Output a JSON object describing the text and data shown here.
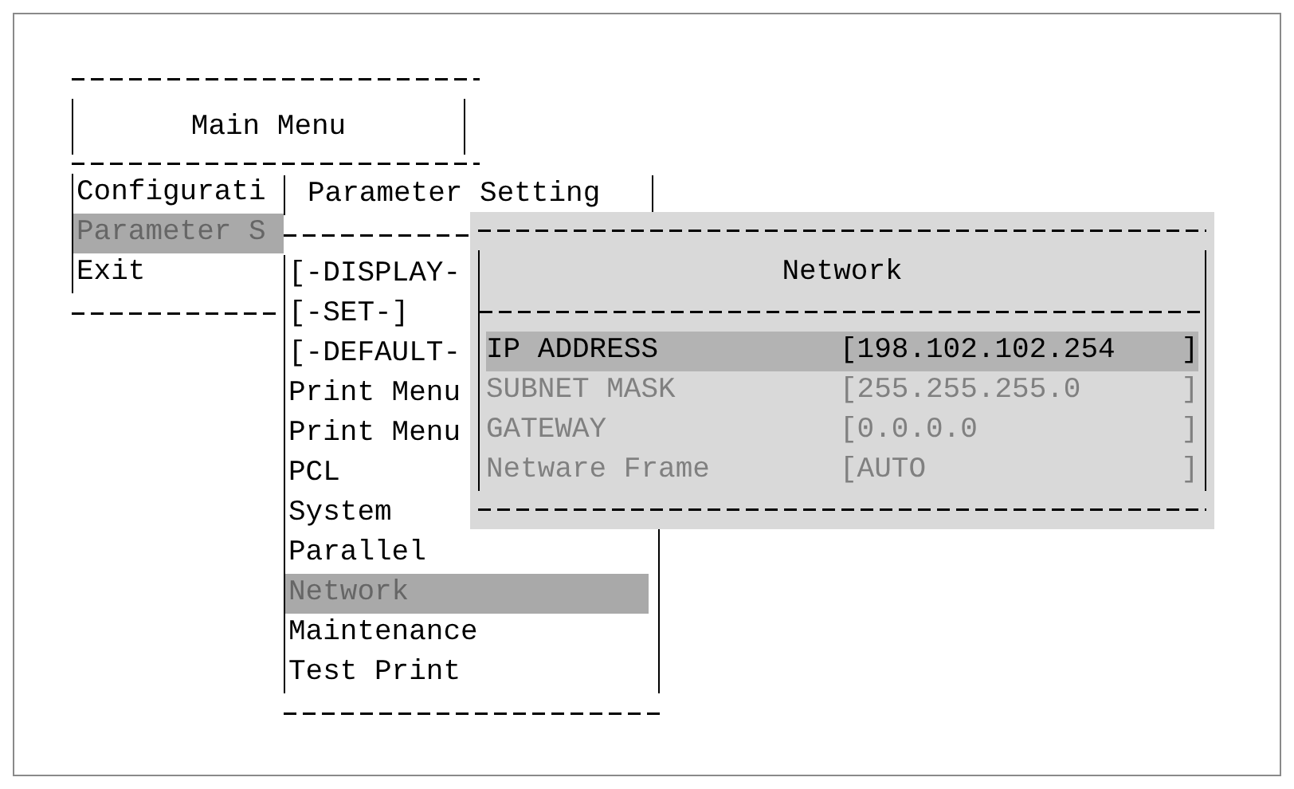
{
  "main_menu": {
    "title": "Main Menu",
    "items": [
      {
        "label": "Configurati",
        "selected": false
      },
      {
        "label": "Parameter S",
        "selected": true
      },
      {
        "label": "Exit",
        "selected": false
      }
    ]
  },
  "parameter_setting": {
    "title": "Parameter Setting",
    "items": [
      {
        "label": "[-DISPLAY-",
        "selected": false
      },
      {
        "label": "[-SET-]",
        "selected": false
      },
      {
        "label": "[-DEFAULT-",
        "selected": false
      },
      {
        "label": "Print Menu",
        "selected": false
      },
      {
        "label": "Print Menu",
        "selected": false
      },
      {
        "label": "PCL",
        "selected": false
      },
      {
        "label": "System",
        "selected": false
      },
      {
        "label": "Parallel",
        "selected": false
      },
      {
        "label": "Network",
        "selected": true
      },
      {
        "label": "Maintenance",
        "selected": false
      },
      {
        "label": "Test Print",
        "selected": false
      }
    ]
  },
  "network": {
    "title": "Network",
    "rows": [
      {
        "label": "IP ADDRESS",
        "value": "[198.102.102.254",
        "close": "]",
        "selected": true
      },
      {
        "label": "SUBNET MASK",
        "value": "[255.255.255.0",
        "close": "]",
        "selected": false
      },
      {
        "label": "GATEWAY",
        "value": "[0.0.0.0",
        "close": "]",
        "selected": false
      },
      {
        "label": "Netware Frame",
        "value": "[AUTO",
        "close": "]",
        "selected": false
      }
    ]
  }
}
